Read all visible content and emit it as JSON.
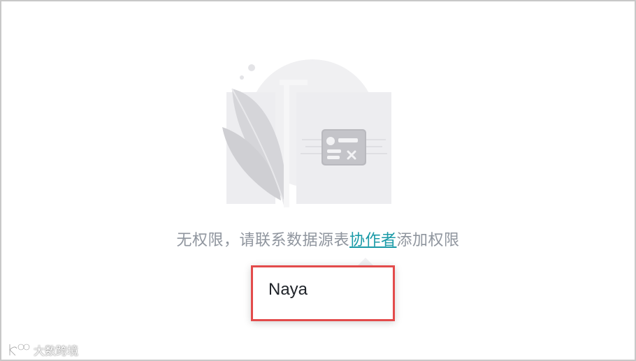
{
  "empty_state": {
    "message_prefix": "无权限，请联系数据源表",
    "message_link": "协作者",
    "message_suffix": "添加权限"
  },
  "popover": {
    "name": "Naya"
  },
  "watermark": {
    "text": "大数跨境"
  },
  "colors": {
    "link": "#1a9aa7",
    "highlight_border": "#e34b4b",
    "message": "#8f959e"
  },
  "icons": [
    "feather-quill-illustration",
    "no-permission-card-icon",
    "watermark-logo-icon"
  ]
}
